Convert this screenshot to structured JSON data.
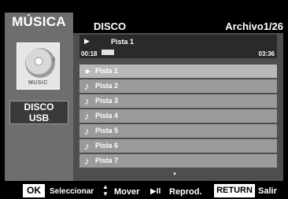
{
  "app": {
    "title": "MÚSICA"
  },
  "header": {
    "section": "DISCO",
    "file_counter": "Archivo1/26"
  },
  "thumbnail": {
    "label": "MUSIC"
  },
  "source": {
    "line1": "DISCO",
    "line2": "USB"
  },
  "now_playing": {
    "title": "Pista 1",
    "elapsed": "00:18",
    "total": "03:36",
    "progress_fraction": 0.083
  },
  "tracks": [
    {
      "label": "Pista 1",
      "selected": true
    },
    {
      "label": "Pista 2",
      "selected": false
    },
    {
      "label": "Pista 3",
      "selected": false
    },
    {
      "label": "Pista 4",
      "selected": false
    },
    {
      "label": "Pista 5",
      "selected": false
    },
    {
      "label": "Pista 6",
      "selected": false
    },
    {
      "label": "Pista 7",
      "selected": false
    }
  ],
  "icons": {
    "play": "▶",
    "note": "♪",
    "left_arrow": "◄",
    "down_arrow": "▼",
    "up_down": "▲▼",
    "play_pause": "▶II"
  },
  "bottom_bar": {
    "ok_key": "OK",
    "ok_hint": "Seleccionar",
    "move_hint": "Mover",
    "play_hint": "Reprod.",
    "return_key": "RETURN",
    "return_hint": "Salir"
  },
  "colors": {
    "panel": "#6e6e6e",
    "list_bg": "#4e4e4e",
    "row": "#9a9a9a",
    "row_selected": "#b8b8b8"
  }
}
